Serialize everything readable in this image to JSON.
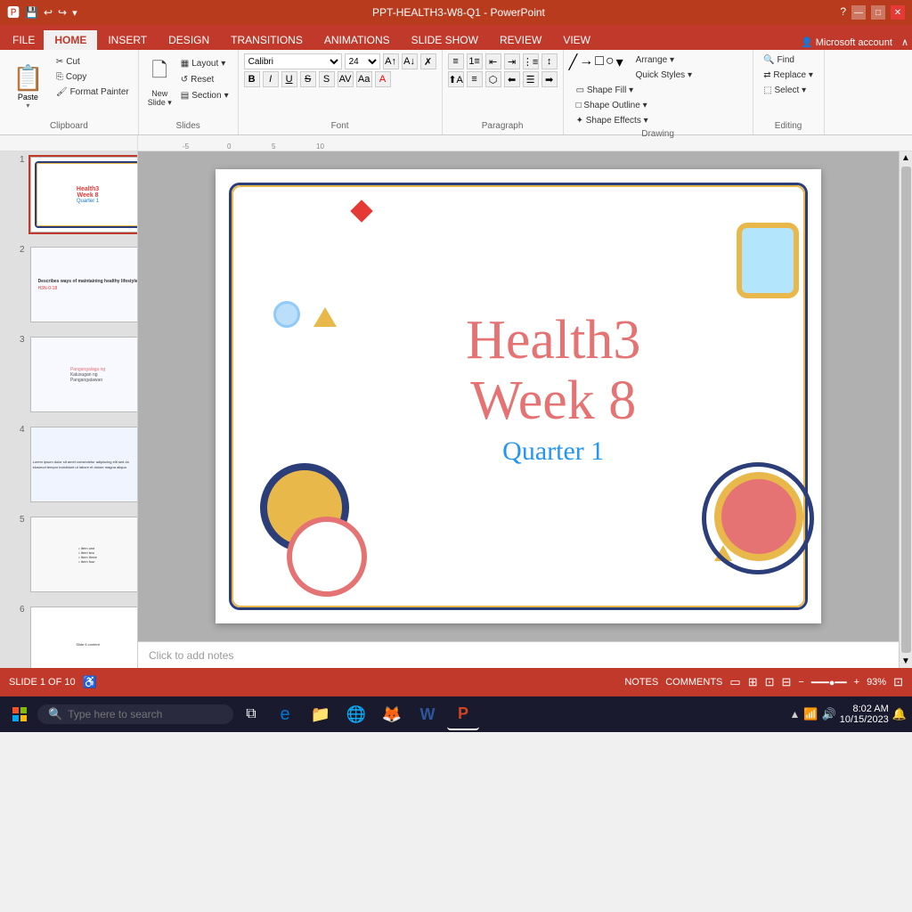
{
  "window": {
    "title": "PPT-HEALTH3-W8-Q1 - PowerPoint",
    "help": "?",
    "minimize": "—",
    "restore": "□",
    "close": "✕"
  },
  "quick_access": {
    "save": "💾",
    "undo": "↩",
    "redo": "↪",
    "customize": "▾"
  },
  "tabs": [
    "FILE",
    "HOME",
    "INSERT",
    "DESIGN",
    "TRANSITIONS",
    "ANIMATIONS",
    "SLIDE SHOW",
    "REVIEW",
    "VIEW"
  ],
  "active_tab": "HOME",
  "ribbon": {
    "clipboard": {
      "label": "Clipboard",
      "paste": "Paste",
      "cut": "Cut",
      "copy": "Copy",
      "format_painter": "Format Painter"
    },
    "slides": {
      "label": "Slides",
      "new_slide": "New\nSlide",
      "layout": "Layout",
      "reset": "Reset",
      "section": "Section"
    },
    "font": {
      "label": "Font",
      "name": "Calibri",
      "size": "24"
    },
    "paragraph": {
      "label": "Paragraph"
    },
    "drawing": {
      "label": "Drawing"
    },
    "editing": {
      "label": "Editing"
    }
  },
  "slide": {
    "title_line1": "Health3",
    "title_line2": "Week 8",
    "subtitle": "Quarter 1"
  },
  "slides_panel": [
    {
      "num": "1",
      "active": true
    },
    {
      "num": "2",
      "active": false
    },
    {
      "num": "3",
      "active": false
    },
    {
      "num": "4",
      "active": false
    },
    {
      "num": "5",
      "active": false
    },
    {
      "num": "6",
      "active": false
    }
  ],
  "notes": {
    "placeholder": "Click to add notes"
  },
  "status": {
    "slide_info": "SLIDE 1 OF 10",
    "notes_btn": "NOTES",
    "comments_btn": "COMMENTS",
    "zoom": "93%"
  },
  "taskbar": {
    "search_placeholder": "Type here to search",
    "time": "8:02 AM",
    "date": "10/15/2023"
  }
}
